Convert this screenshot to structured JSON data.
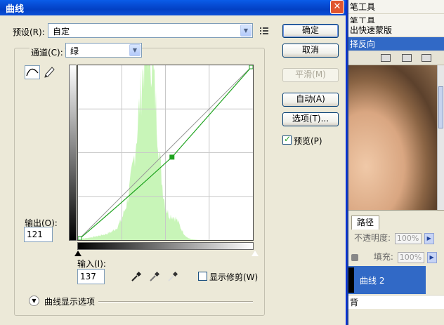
{
  "dialog": {
    "title": "曲线",
    "close_glyph": "✕",
    "preset_label": "预设(R):",
    "preset_value": "自定",
    "channel_label": "通道(C):",
    "channel_value": "绿",
    "output_label": "输出(O):",
    "output_value": "121",
    "input_label": "输入(I):",
    "input_value": "137",
    "show_clipping_label": "显示修剪(W)",
    "show_clipping_checked": false,
    "display_options_label": "曲线显示选项",
    "preview_label": "预览(P)",
    "preview_checked": true
  },
  "buttons": {
    "ok": "确定",
    "cancel": "取消",
    "smooth": "平滑(M)",
    "auto": "自动(A)",
    "options": "选项(T)..."
  },
  "curve": {
    "channel_color": "#1fa31f",
    "histogram_color": "#c8f5b8",
    "control_point_input": 137,
    "control_point_output": 121,
    "range_max": 255
  },
  "background": {
    "menu_items": [
      "笔工具",
      "笔工具",
      "出快速蒙版",
      "择反向"
    ],
    "selected_menu_index": 3,
    "layers_tab": "路径",
    "opacity_label": "不透明度:",
    "opacity_value": "100%",
    "fill_label": "填充:",
    "fill_value": "100%",
    "layer_name": "曲线 2",
    "layer_below": "背"
  }
}
